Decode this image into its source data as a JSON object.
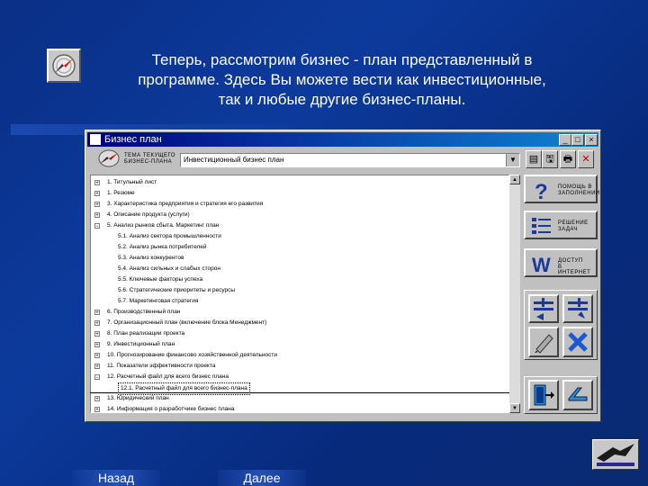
{
  "slide": {
    "title_lines": [
      "Теперь, рассмотрим бизнес - план представленный в",
      "программе. Здесь Вы можете вести как инвестиционные,",
      "так и любые другие бизнес-планы."
    ]
  },
  "window": {
    "title": "Бизнес план",
    "controls": {
      "minimize": "_",
      "maximize": "□",
      "close": "×"
    }
  },
  "toolbar": {
    "topic_label_line1": "ТЕМА ТЕКУЩЕГО",
    "topic_label_line2": "БИЗНЕС-ПЛАНА",
    "plan_type_value": "Инвестиционный бизнес план",
    "combo_arrow": "▼",
    "buttons": [
      "▤",
      "🖫",
      "🖶",
      "✕"
    ]
  },
  "tree": {
    "rows": [
      {
        "label": "1. Титульный лист",
        "level": 0,
        "expander": "+"
      },
      {
        "label": "1. Резюме",
        "level": 0,
        "expander": "+"
      },
      {
        "label": "3. Характеристика предприятия и стратегия его развития",
        "level": 0,
        "expander": "+"
      },
      {
        "label": "4. Описание продукта (услуги)",
        "level": 0,
        "expander": "+"
      },
      {
        "label": "5. Анализ рынков сбыта. Маркетинг план",
        "level": 0,
        "expander": "−"
      },
      {
        "label": "5.1. Анализ сектора промышленности",
        "level": 1,
        "expander": ""
      },
      {
        "label": "5.2. Анализ рынка потребителей",
        "level": 1,
        "expander": ""
      },
      {
        "label": "5.3. Анализ конкурентов",
        "level": 1,
        "expander": ""
      },
      {
        "label": "5.4. Анализ сильных и слабых сторон",
        "level": 1,
        "expander": ""
      },
      {
        "label": "5.5. Ключевые факторы успеха",
        "level": 1,
        "expander": ""
      },
      {
        "label": "5.6. Стратегические приоритеты и ресурсы",
        "level": 1,
        "expander": ""
      },
      {
        "label": "5.7. Маркетинговая стратегия",
        "level": 1,
        "expander": ""
      },
      {
        "label": "6. Производственный план",
        "level": 0,
        "expander": "+"
      },
      {
        "label": "7. Организационный план (включение блока Менеджмент)",
        "level": 0,
        "expander": "+"
      },
      {
        "label": "8. План реализации проекта",
        "level": 0,
        "expander": "+"
      },
      {
        "label": "9. Инвестиционный план",
        "level": 0,
        "expander": "+"
      },
      {
        "label": "10. Прогнозирование финансово хозяйственной деятельности",
        "level": 0,
        "expander": "+"
      },
      {
        "label": "11. Показатели эффективности проекта",
        "level": 0,
        "expander": "+"
      },
      {
        "label": "12. Расчетный файл для всего бизнес плана",
        "level": 0,
        "expander": "−"
      },
      {
        "label": "12.1. Расчетный файл для всего бизнес-плана",
        "level": 1,
        "expander": "",
        "selected": true
      },
      {
        "label": "13. Юридический план",
        "level": 0,
        "expander": "+"
      },
      {
        "label": "14. Информация о разработчике бизнес плана",
        "level": 0,
        "expander": "+"
      }
    ]
  },
  "right_panel": {
    "help_line1": "ПОМОЩЬ В",
    "help_line2": "ЗАПОЛНЕНИИ",
    "tasks_line1": "РЕШЕНИЕ",
    "tasks_line2": "ЗАДАЧ",
    "internet_line1": "ДОСТУП",
    "internet_line2": "В ИНТЕРНЕТ"
  },
  "nav": {
    "back": "Назад",
    "next": "Далее"
  },
  "colors": {
    "background": "#0b3593",
    "window": "#c0c0c0",
    "titlebar": "#000080"
  }
}
